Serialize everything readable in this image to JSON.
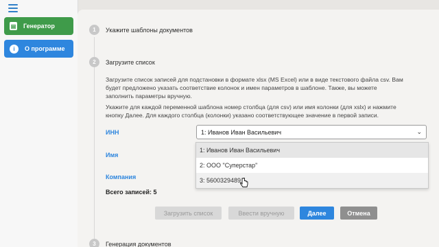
{
  "sidebar": {
    "menu_icon": "hamburger-icon",
    "items": [
      {
        "label": "Генератор",
        "icon": "document-icon",
        "color": "#3f9b4a"
      },
      {
        "label": "О программе",
        "icon": "info-icon",
        "color": "#2e86de"
      }
    ]
  },
  "steps": [
    {
      "number": "1",
      "title": "Укажите шаблоны документов"
    },
    {
      "number": "2",
      "title": "Загрузите список"
    },
    {
      "number": "3",
      "title": "Генерация документов"
    }
  ],
  "step2": {
    "paragraph1_line1": "Загрузите список записей для подстановки в формате xlsx (MS Excel) или в виде текстового файла csv. Вам",
    "paragraph1_line2": "будет предложено указать соответствие колонок и имен параметров в шаблоне. Также, вы можете",
    "paragraph1_line3": "заполнить параметры вручную.",
    "paragraph2_line1": "Укажите для каждой переменной шаблона номер столбца (для csv) или имя колонки (для xslx) и нажмите",
    "paragraph2_line2": "кнопку Далее. Для каждого столбца (колонки) указано соответствующее значение в первой записи.",
    "fields": [
      {
        "label": "ИНН"
      },
      {
        "label": "Имя"
      },
      {
        "label": "Компания"
      }
    ],
    "select_value": "1: Иванов Иван Васильевич",
    "dropdown_options": [
      "1: Иванов Иван Васильевич",
      "2: ООО \"Суперстар\"",
      "3: 5600329489"
    ],
    "total_records": "Всего записей: 5",
    "buttons": {
      "upload": "Загрузить список",
      "manual": "Ввести вручную",
      "next": "Далее",
      "cancel": "Отмена"
    }
  },
  "colors": {
    "accent": "#2e86de",
    "success": "#3f9b4a",
    "cancel": "#8f8f8f"
  }
}
